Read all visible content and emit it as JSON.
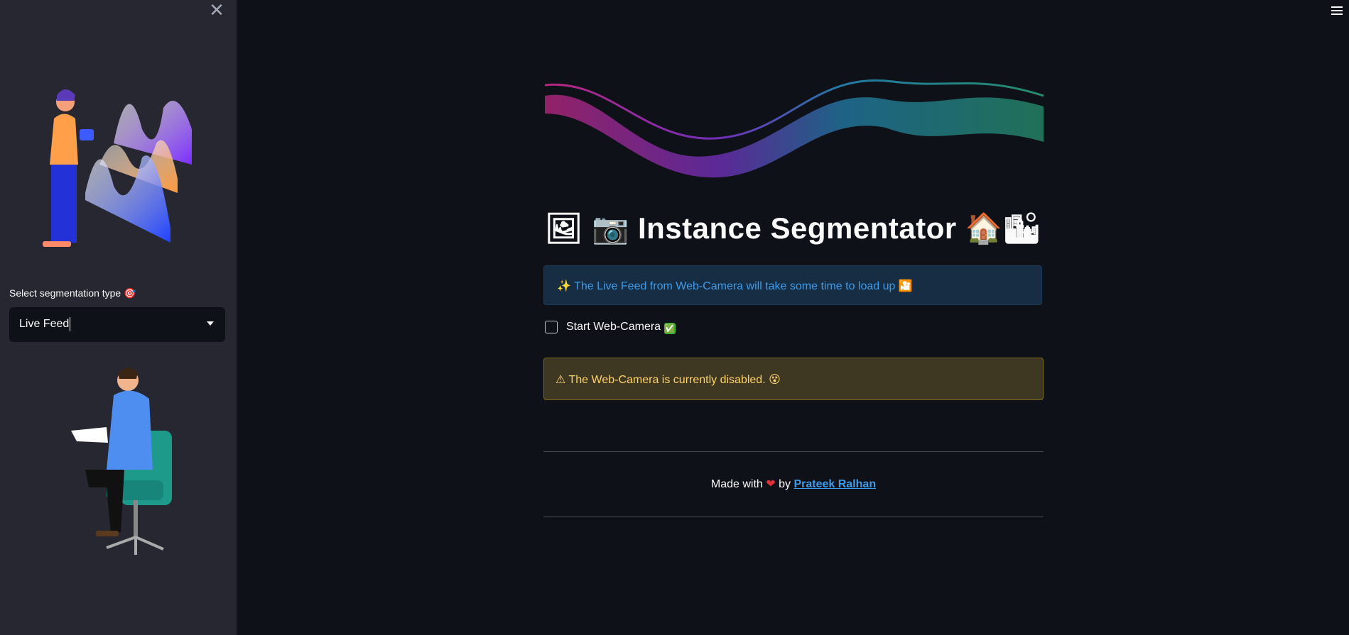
{
  "sidebar": {
    "close_glyph": "✕",
    "select_label": "Select segmentation type",
    "select_label_icon": "🎯",
    "select_value": "Live Feed"
  },
  "main": {
    "title": "🖼 📷 Instance Segmentator 🏠🏙",
    "info_text": "✨ The Live Feed from Web-Camera will take some time to load up 🎦",
    "checkbox_label": "Start Web-Camera",
    "checkbox_icon": "✅",
    "warning_text": "⚠ The Web-Camera is currently disabled. 😵",
    "footer_prefix": "Made with",
    "footer_heart": "❤",
    "footer_by": "by",
    "footer_link": "Prateek Ralhan"
  },
  "colors": {
    "background": "#0e1117",
    "sidebar": "#262730",
    "info_text": "#3c9beb",
    "warning_text": "#ffd16a",
    "link": "#3c9beb"
  },
  "icons": [
    "close-icon",
    "menu-icon",
    "target-icon",
    "check-icon",
    "heart-icon",
    "dropdown-caret-icon"
  ]
}
